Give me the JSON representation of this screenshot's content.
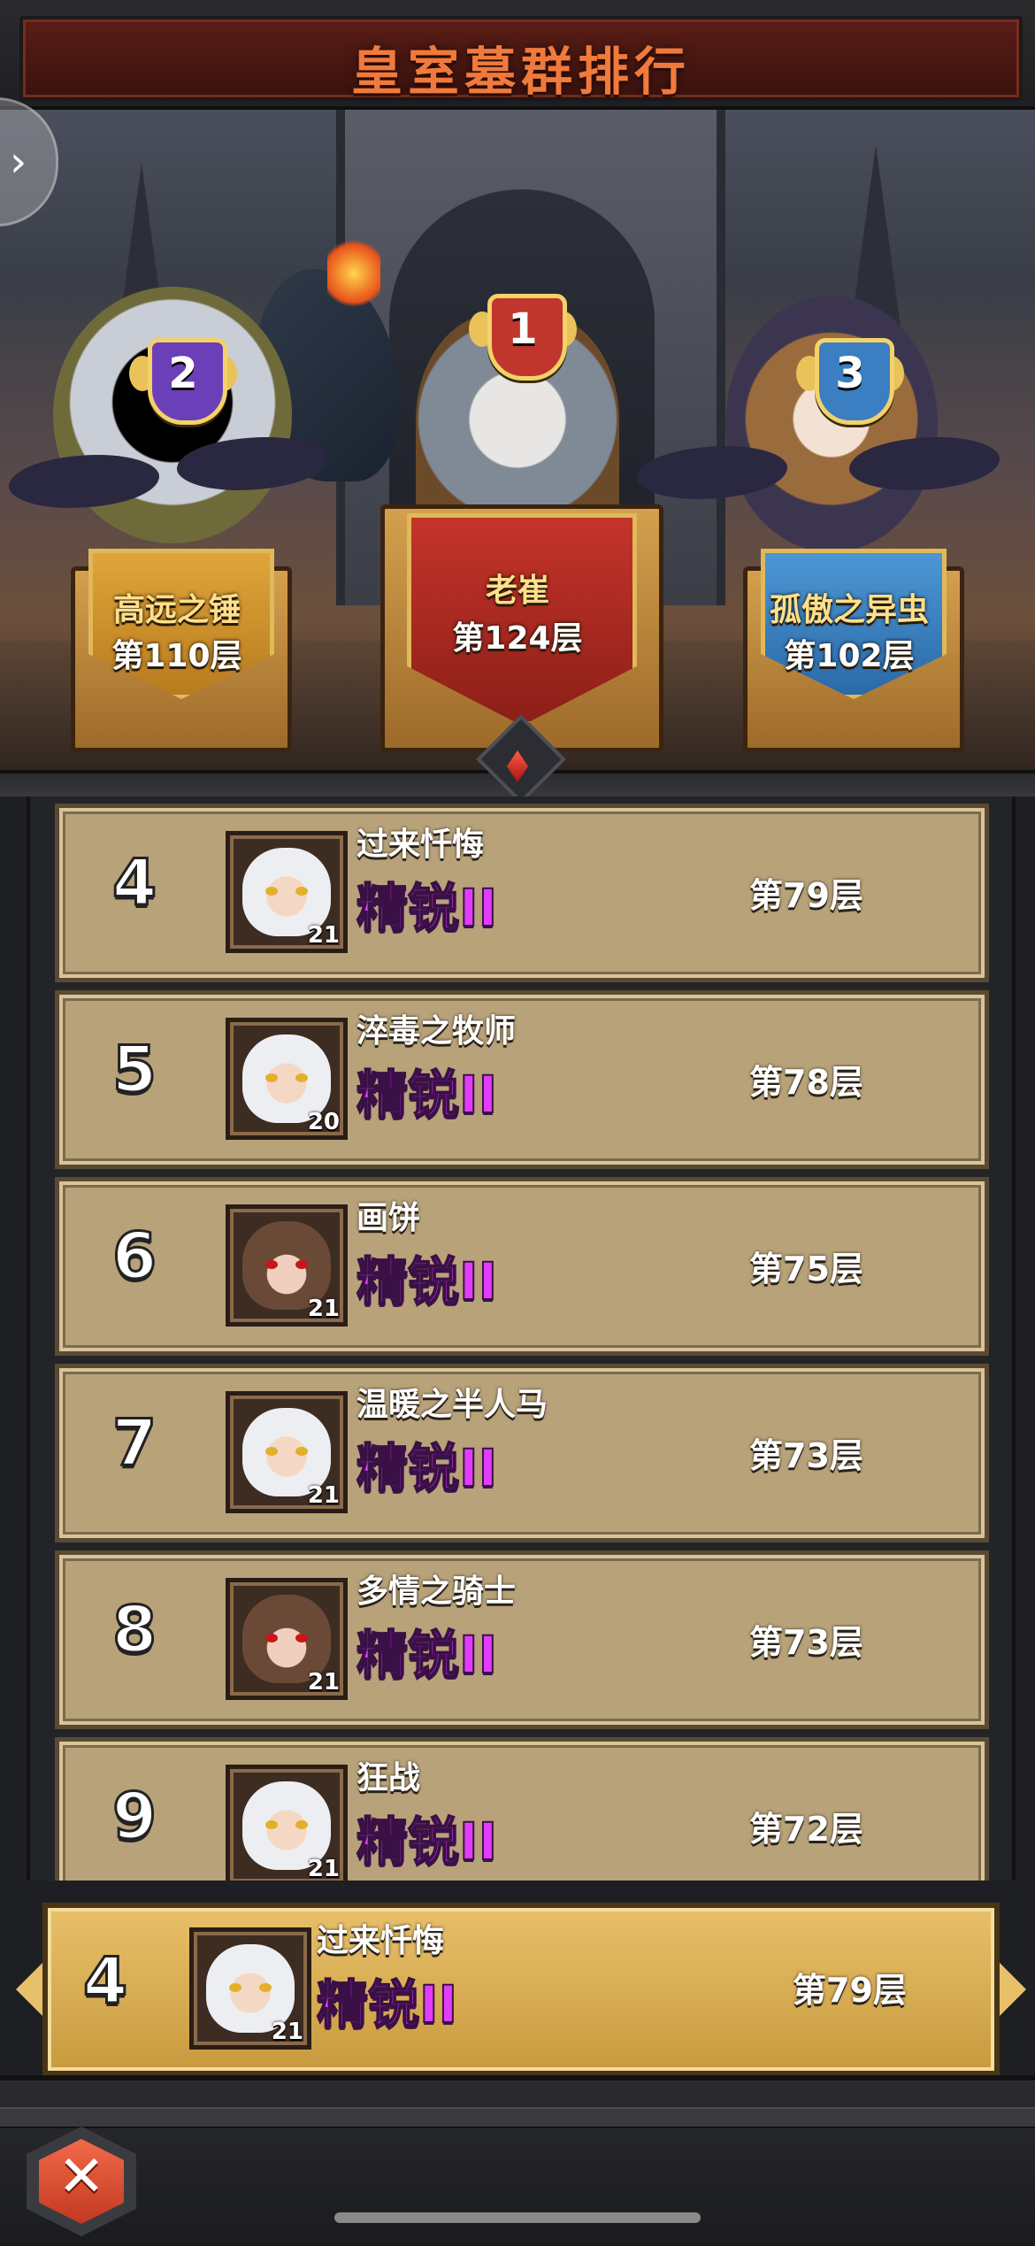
{
  "header": {
    "title": "皇室墓群排行",
    "warn_icon_text": "!"
  },
  "podium": [
    {
      "rank": "2",
      "name": "高远之锤",
      "floor": "第110层",
      "badge_color": "#6a3fb8"
    },
    {
      "rank": "1",
      "name": "老崔",
      "floor": "第124层",
      "badge_color": "#c0362c"
    },
    {
      "rank": "3",
      "name": "孤傲之异虫",
      "floor": "第102层",
      "badge_color": "#3b7ec2"
    }
  ],
  "list": [
    {
      "rank": "4",
      "name": "过来忏悔",
      "tier": "精锐II",
      "floor": "第79层",
      "level": "21",
      "avatar": "white-hair-hero"
    },
    {
      "rank": "5",
      "name": "淬毒之牧师",
      "tier": "精锐II",
      "floor": "第78层",
      "level": "20",
      "avatar": "white-hair-hero"
    },
    {
      "rank": "6",
      "name": "画饼",
      "tier": "精锐II",
      "floor": "第75层",
      "level": "21",
      "avatar": "hooded-hero"
    },
    {
      "rank": "7",
      "name": "温暖之半人马",
      "tier": "精锐II",
      "floor": "第73层",
      "level": "21",
      "avatar": "white-hair-hero"
    },
    {
      "rank": "8",
      "name": "多情之骑士",
      "tier": "精锐II",
      "floor": "第73层",
      "level": "21",
      "avatar": "hooded-hero"
    },
    {
      "rank": "9",
      "name": "狂战",
      "tier": "精锐II",
      "floor": "第72层",
      "level": "21",
      "avatar": "white-hair-hero"
    }
  ],
  "self": {
    "rank": "4",
    "name": "过来忏悔",
    "tier": "精锐II",
    "floor": "第79层",
    "level": "21",
    "avatar": "white-hair-hero"
  },
  "colors": {
    "tier_text": "#e23dfc",
    "title_text": "#f07a3c",
    "row_bg": "#b8a27a",
    "self_row_bg": "#e8c06a"
  },
  "controls": {
    "close_icon": "close-x-icon",
    "side_icon": "chevron-right-icon",
    "close_glyph": "✕",
    "side_glyph": "›"
  }
}
